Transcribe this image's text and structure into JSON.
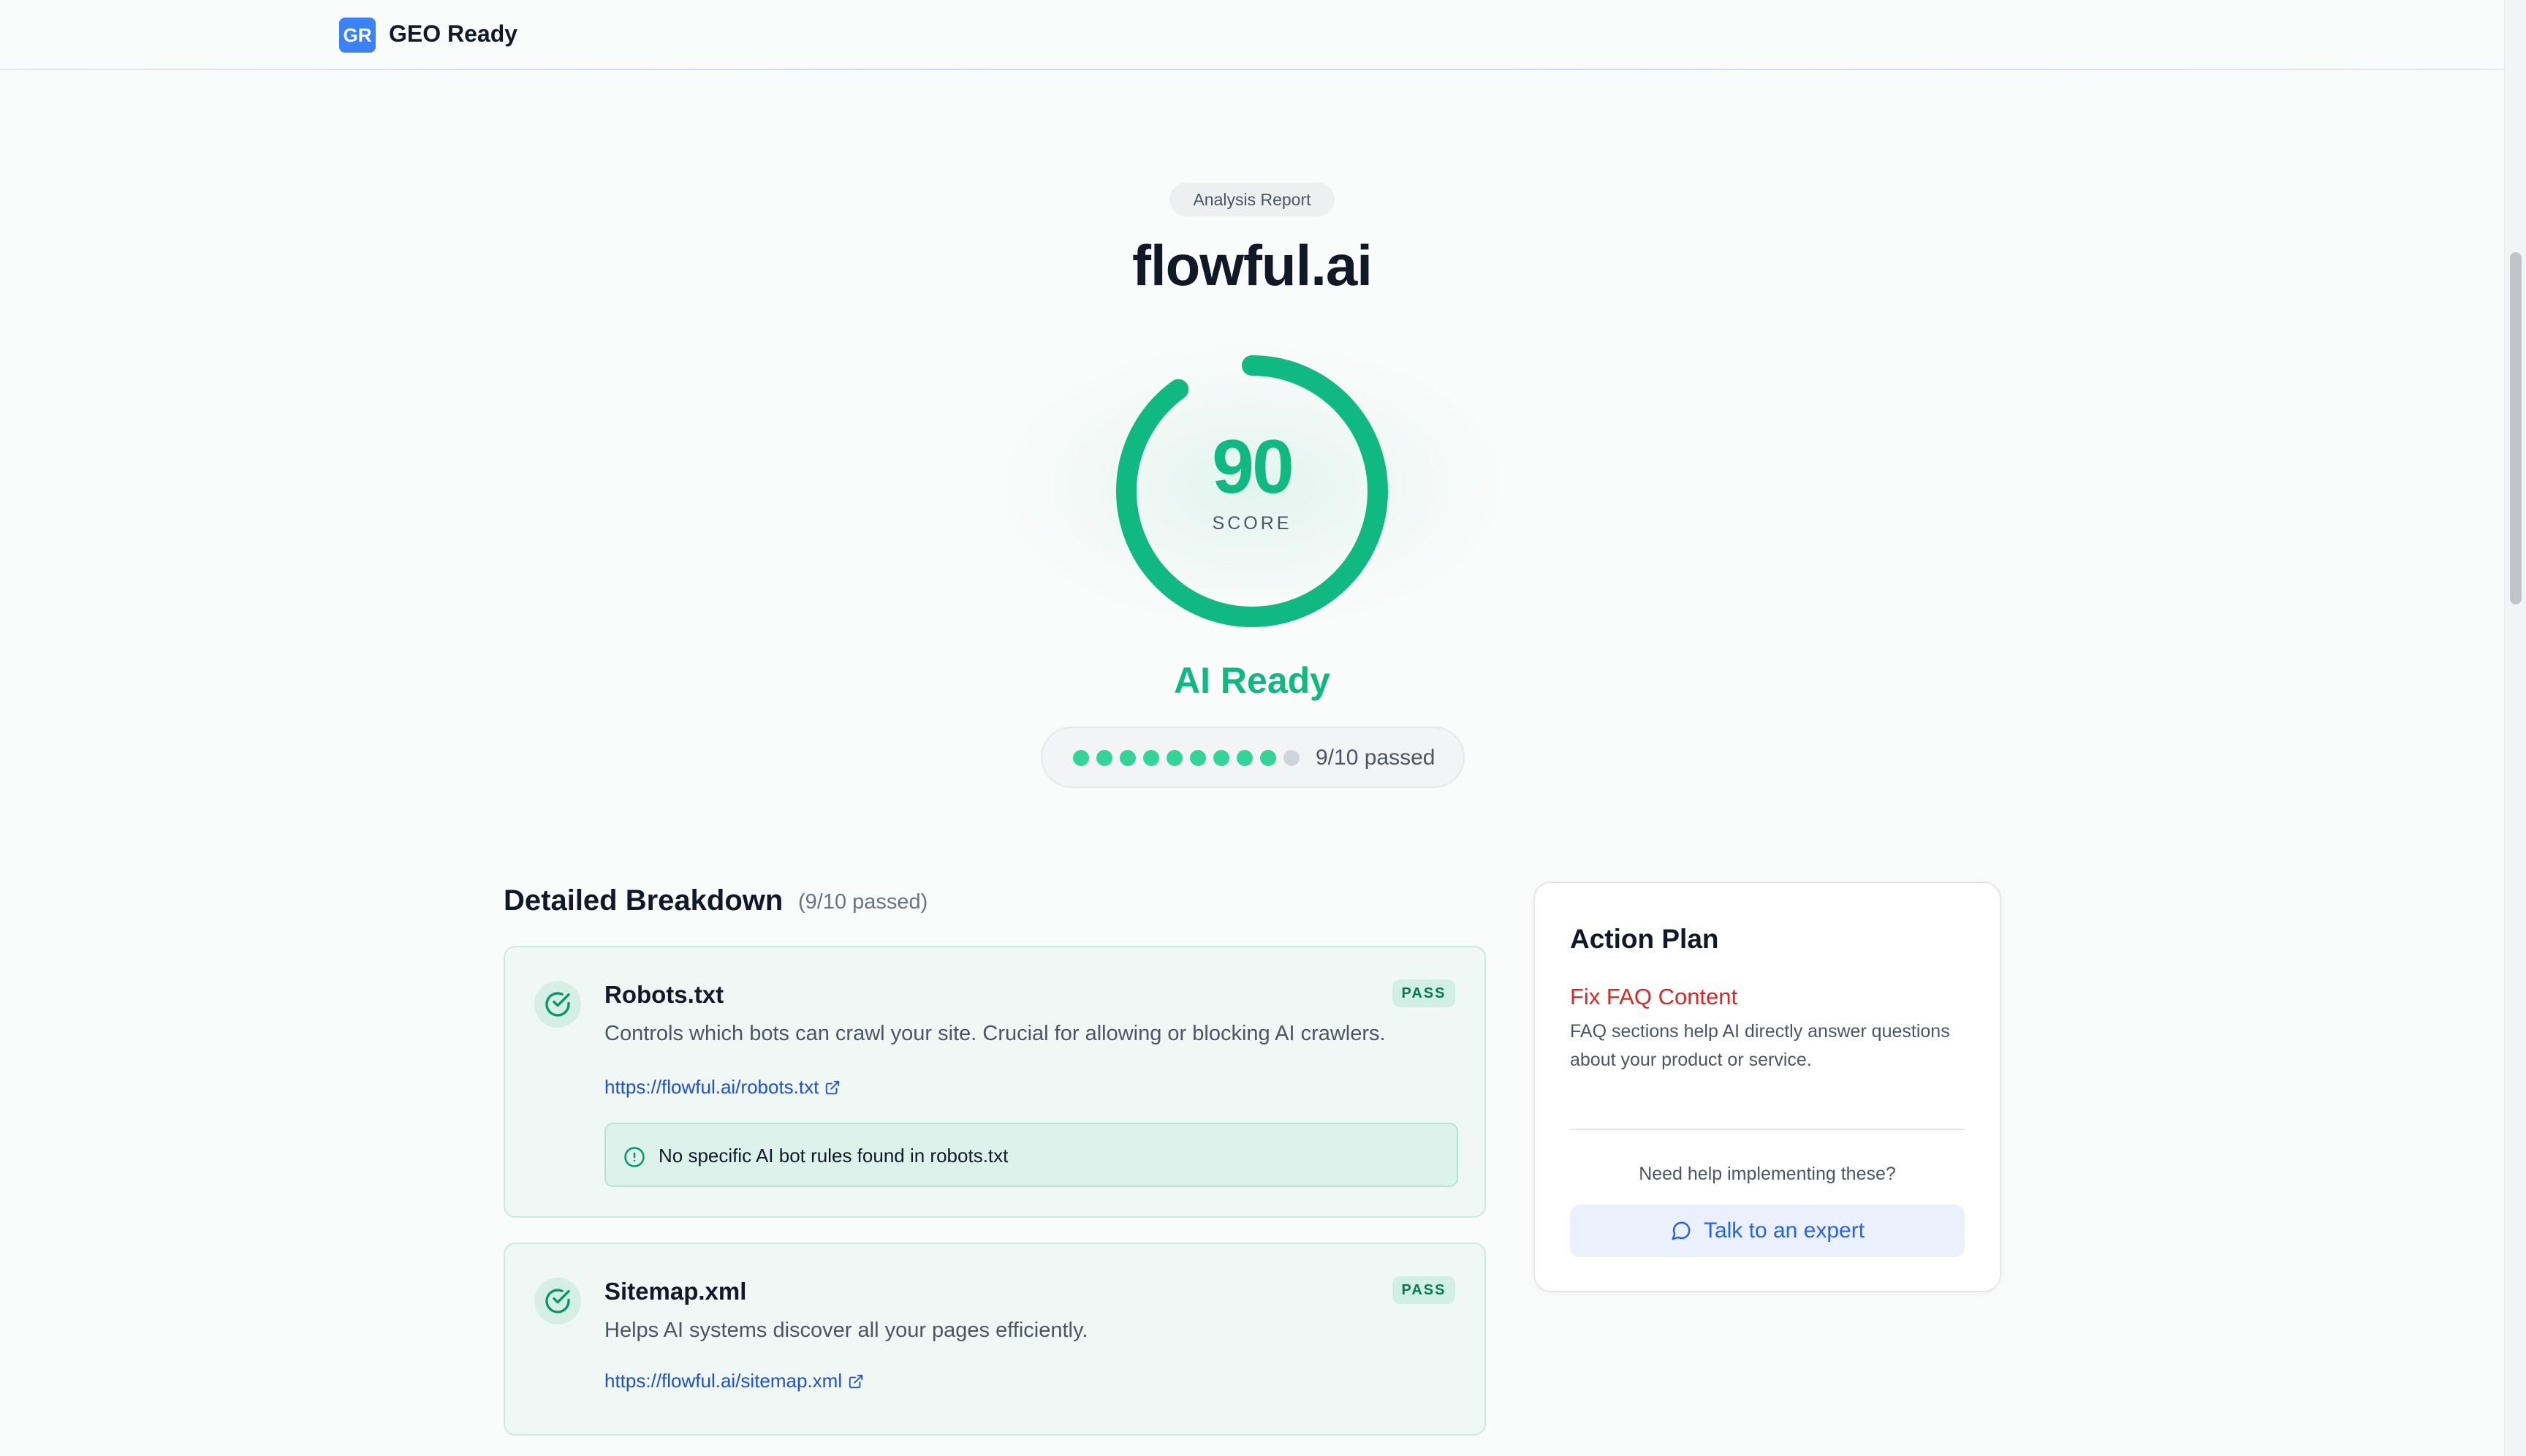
{
  "header": {
    "logo_text": "GR",
    "brand_name": "GEO Ready"
  },
  "hero": {
    "report_label": "Analysis Report",
    "domain": "flowful.ai",
    "score": "90",
    "score_fraction": 0.9,
    "score_label": "SCORE",
    "status": "AI Ready",
    "passed_count": 9,
    "total_count": 10,
    "passed_text": "9/10 passed"
  },
  "breakdown": {
    "title": "Detailed Breakdown",
    "count": "(9/10 passed)",
    "checks": [
      {
        "title": "Robots.txt",
        "status": "PASS",
        "description": "Controls which bots can crawl your site. Crucial for allowing or blocking AI crawlers.",
        "link": "https://flowful.ai/robots.txt",
        "note": "No specific AI bot rules found in robots.txt"
      },
      {
        "title": "Sitemap.xml",
        "status": "PASS",
        "description": "Helps AI systems discover all your pages efficiently.",
        "link": "https://flowful.ai/sitemap.xml"
      }
    ]
  },
  "action_plan": {
    "title": "Action Plan",
    "item_title": "Fix FAQ Content",
    "item_description": "FAQ sections help AI directly answer questions about your product or service.",
    "help_text": "Need help implementing these?",
    "button_label": "Talk to an expert"
  },
  "colors": {
    "accent_green": "#10b981",
    "pass_dot": "#34d399",
    "fail_dot": "#d1d5db",
    "brand_blue": "#3b82f6",
    "danger_red": "#dc2626",
    "link_blue": "#1d4ed8"
  },
  "icons": {
    "check": "check-circle-icon",
    "external": "external-link-icon",
    "info": "info-circle-icon",
    "chat": "chat-bubble-icon"
  }
}
